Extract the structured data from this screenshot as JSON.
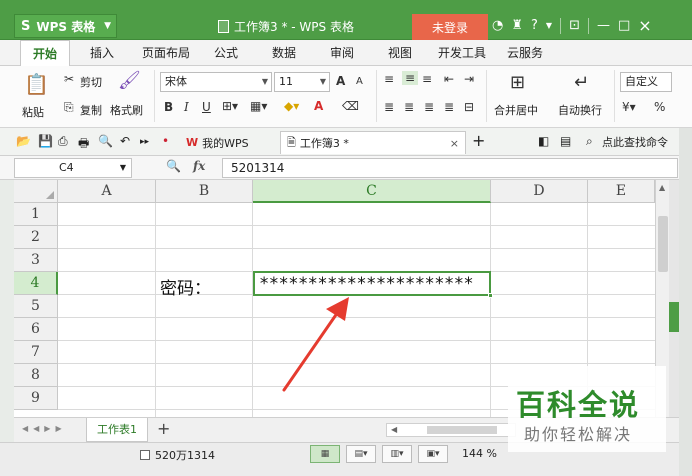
{
  "titlebar": {
    "app_logo": "S",
    "app_name": "WPS 表格",
    "doc_title": "工作簿3 * - WPS 表格",
    "login_label": "未登录",
    "icons": [
      "skin-icon",
      "shirt-icon",
      "help-icon",
      "restore-icon",
      "minimize-icon",
      "maximize-icon",
      "close-icon"
    ],
    "help_label": "?",
    "min_label": "—",
    "max_label": "□",
    "close_label": "×"
  },
  "menu": {
    "tabs": [
      "开始",
      "插入",
      "页面布局",
      "公式",
      "数据",
      "审阅",
      "视图",
      "开发工具",
      "云服务"
    ],
    "active": "开始"
  },
  "ribbon": {
    "paste": "粘贴",
    "cut": "剪切",
    "copy": "复制",
    "format_painter": "格式刷",
    "font_name": "宋体",
    "font_size": "11",
    "grow_font": "A",
    "shrink_font": "A",
    "bold": "B",
    "italic": "I",
    "underline": "U",
    "font_color_label": "A",
    "merge_center": "合并居中",
    "wrap_text": "自动换行",
    "number_format": "自定义",
    "percent": "%"
  },
  "quickaccess": {
    "tabs": [
      {
        "label": "我的WPS",
        "active": false
      },
      {
        "label": "工作簿3 *",
        "active": true
      }
    ],
    "close_tab": "×",
    "add_tab": "+",
    "search_label": "点此查找命令"
  },
  "formulabar": {
    "cell_ref": "C4",
    "fx_label": "fx",
    "formula_value": "5201314"
  },
  "sheet": {
    "columns": [
      "A",
      "B",
      "C",
      "D",
      "E"
    ],
    "rows": [
      "1",
      "2",
      "3",
      "4",
      "5",
      "6",
      "7",
      "8",
      "9"
    ],
    "selected_column": "C",
    "selected_row": "4",
    "cells": {
      "B4": "密码：",
      "C4": "**********************"
    }
  },
  "sheettabs": {
    "tabs": [
      "工作表1"
    ],
    "add_label": "+"
  },
  "statusbar": {
    "sum_text": "520万1314",
    "zoom": "144 %",
    "minus_label": "−"
  },
  "watermark": {
    "title": "百科全说",
    "subtitle": "助你轻松解决"
  },
  "colors": {
    "brand_green": "#4e9d46",
    "selection_green": "#4a9a41",
    "login_orange": "#e8664a",
    "arrow_red": "#e53b2f"
  }
}
